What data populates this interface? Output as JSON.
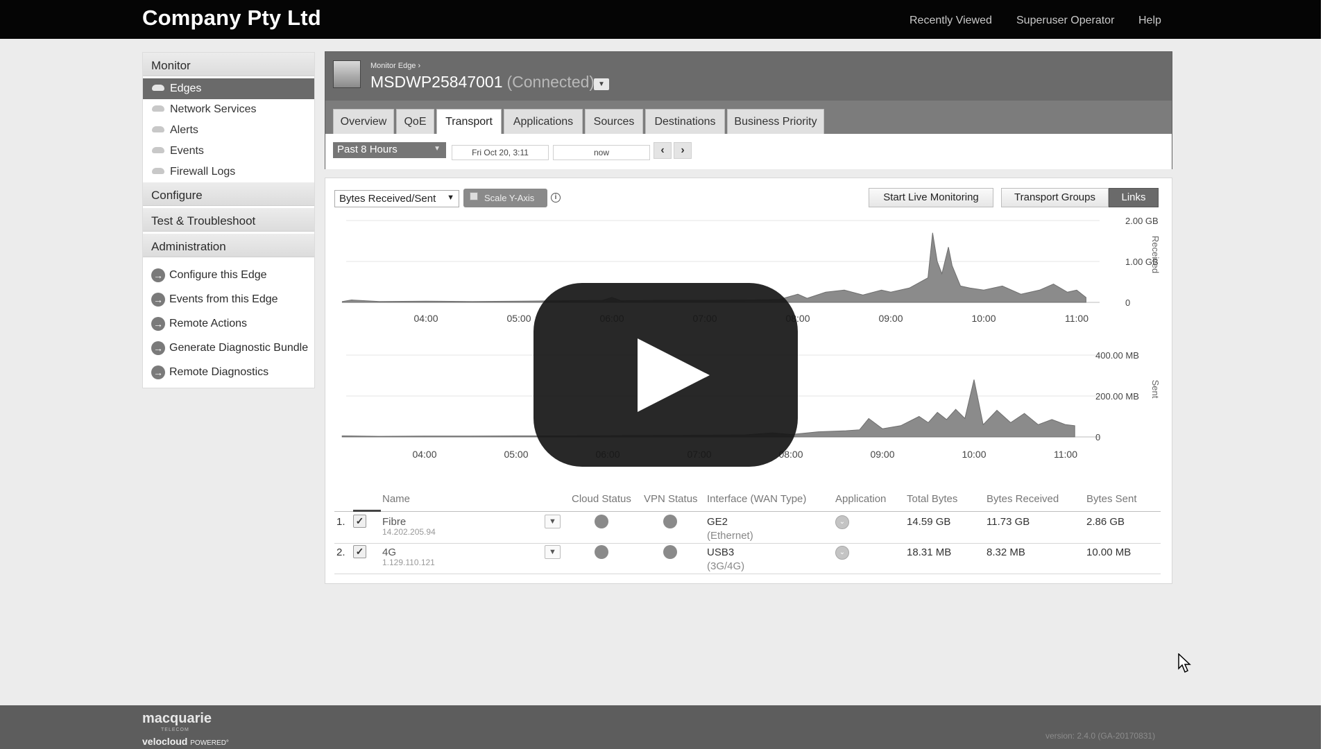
{
  "brand": "Company Pty Ltd",
  "topnav": [
    "Recently Viewed",
    "Superuser Operator",
    "Help"
  ],
  "sidebar": {
    "monitor": "Monitor",
    "monitor_items": [
      "Edges",
      "Network Services",
      "Alerts",
      "Events",
      "Firewall Logs"
    ],
    "configure": "Configure",
    "test": "Test & Troubleshoot",
    "administration": "Administration",
    "actions": [
      "Configure this Edge",
      "Events from this Edge",
      "Remote Actions",
      "Generate Diagnostic Bundle",
      "Remote Diagnostics"
    ]
  },
  "edge": {
    "breadcrumb": "Monitor Edge ›",
    "name": "MSDWP25847001",
    "status": "(Connected)"
  },
  "tabs": [
    "Overview",
    "QoE",
    "Transport",
    "Applications",
    "Sources",
    "Destinations",
    "Business Priority"
  ],
  "active_tab": "Transport",
  "time": {
    "range": "Past 8 Hours",
    "from": "Fri Oct 20, 3:11",
    "to": "now"
  },
  "controls": {
    "metric": "Bytes Received/Sent",
    "scale": "Scale Y-Axis",
    "live": "Start Live Monitoring",
    "transport_groups": "Transport Groups",
    "links": "Links"
  },
  "chart_data": [
    {
      "type": "area",
      "title": "",
      "ylabel": "Received",
      "x_ticks": [
        "04:00",
        "05:00",
        "06:00",
        "07:00",
        "08:00",
        "09:00",
        "10:00",
        "11:00"
      ],
      "y_ticks": [
        "2.00 GB",
        "1.00 GB",
        "0"
      ],
      "ylim": [
        0,
        2.0
      ],
      "unit": "GB",
      "x": [
        3.1,
        3.2,
        3.5,
        4.0,
        4.5,
        5.0,
        5.5,
        5.9,
        6.0,
        6.1,
        6.5,
        7.0,
        7.5,
        7.8,
        8.0,
        8.1,
        8.3,
        8.5,
        8.7,
        8.9,
        9.0,
        9.2,
        9.4,
        9.45,
        9.5,
        9.55,
        9.62,
        9.66,
        9.75,
        9.85,
        10.0,
        10.2,
        10.4,
        10.6,
        10.75,
        10.9,
        11.0,
        11.1
      ],
      "values": [
        0.02,
        0.06,
        0.02,
        0.03,
        0.02,
        0.03,
        0.04,
        0.05,
        0.12,
        0.04,
        0.05,
        0.05,
        0.06,
        0.07,
        0.2,
        0.1,
        0.25,
        0.3,
        0.18,
        0.3,
        0.25,
        0.35,
        0.6,
        1.7,
        1.0,
        0.7,
        1.35,
        0.9,
        0.4,
        0.35,
        0.3,
        0.4,
        0.2,
        0.3,
        0.45,
        0.25,
        0.3,
        0.12
      ]
    },
    {
      "type": "area",
      "title": "",
      "ylabel": "Sent",
      "x_ticks": [
        "04:00",
        "05:00",
        "06:00",
        "07:00",
        "08:00",
        "09:00",
        "10:00",
        "11:00"
      ],
      "y_ticks": [
        "400.00 MB",
        "200.00 MB",
        "0"
      ],
      "ylim": [
        0,
        400
      ],
      "unit": "MB",
      "x": [
        3.1,
        3.5,
        4.0,
        4.5,
        5.0,
        5.5,
        6.0,
        6.5,
        7.0,
        7.5,
        7.8,
        8.0,
        8.3,
        8.6,
        8.75,
        8.85,
        9.0,
        9.2,
        9.4,
        9.5,
        9.6,
        9.7,
        9.8,
        9.9,
        10.0,
        10.1,
        10.25,
        10.4,
        10.55,
        10.7,
        10.85,
        11.0,
        11.1
      ],
      "values": [
        5,
        3,
        4,
        4,
        5,
        5,
        6,
        7,
        8,
        10,
        20,
        12,
        25,
        30,
        35,
        90,
        40,
        55,
        100,
        70,
        120,
        85,
        135,
        90,
        280,
        60,
        130,
        70,
        115,
        60,
        85,
        60,
        55
      ]
    }
  ],
  "table": {
    "headers": [
      "Name",
      "Cloud Status",
      "VPN Status",
      "Interface (WAN Type)",
      "Application",
      "Total Bytes",
      "Bytes Received",
      "Bytes Sent"
    ],
    "rows": [
      {
        "num": "1.",
        "name": "Fibre",
        "ip": "14.202.205.94",
        "iface": "GE2",
        "wan": "(Ethernet)",
        "total": "14.59 GB",
        "received": "11.73 GB",
        "sent": "2.86 GB"
      },
      {
        "num": "2.",
        "name": "4G",
        "ip": "1.129.110.121",
        "iface": "USB3",
        "wan": "(3G/4G)",
        "total": "18.31 MB",
        "received": "8.32 MB",
        "sent": "10.00 MB"
      }
    ]
  },
  "footer": {
    "logo": "macquarie",
    "tele": "TELECOM",
    "vc": "velocloud",
    "powered": "POWERED°",
    "version": "version: 2.4.0 (GA-20170831)"
  }
}
